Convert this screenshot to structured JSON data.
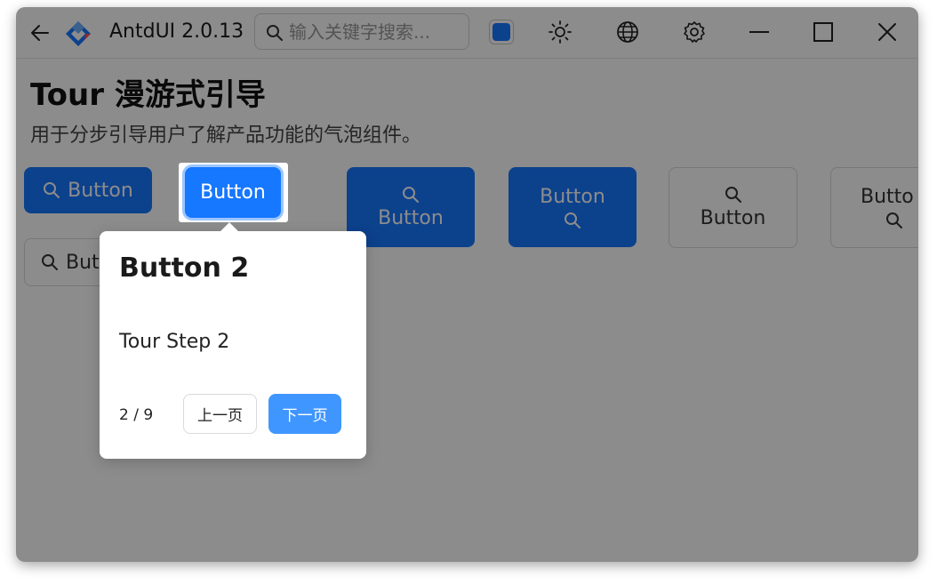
{
  "window": {
    "app_title": "AntdUI 2.0.13",
    "search": {
      "placeholder": "输入关键字搜索..."
    },
    "accent_color": "#1677ff",
    "icons": [
      "back-arrow-icon",
      "antdui-logo-icon",
      "search-icon",
      "sun-icon",
      "globe-icon",
      "gear-icon",
      "minimize-icon",
      "maximize-icon",
      "close-icon"
    ]
  },
  "page": {
    "title": "Tour 漫游式引导",
    "description": "用于分步引导用户了解产品功能的气泡组件。"
  },
  "buttons": [
    {
      "label": "Button",
      "style": "primary",
      "icon": "search-icon",
      "icon_position": "left"
    },
    {
      "label": "Button",
      "style": "primary",
      "icon": null,
      "highlighted": true
    },
    {
      "label": "Button",
      "style": "primary",
      "icon": "search-icon",
      "icon_position": "top"
    },
    {
      "label": "Button",
      "style": "primary",
      "icon": "search-icon",
      "icon_position": "bottom"
    },
    {
      "label": "Button",
      "style": "default",
      "icon": "search-icon",
      "icon_position": "top"
    },
    {
      "label": "Butto",
      "style": "default",
      "icon": "search-icon",
      "icon_position": "bottom"
    },
    {
      "label": "But",
      "style": "default",
      "icon": "search-icon",
      "icon_position": "left"
    }
  ],
  "tour": {
    "title": "Button 2",
    "body": "Tour Step 2",
    "counter": "2 / 9",
    "prev_label": "上一页",
    "next_label": "下一页",
    "next_color": "#4096ff"
  }
}
